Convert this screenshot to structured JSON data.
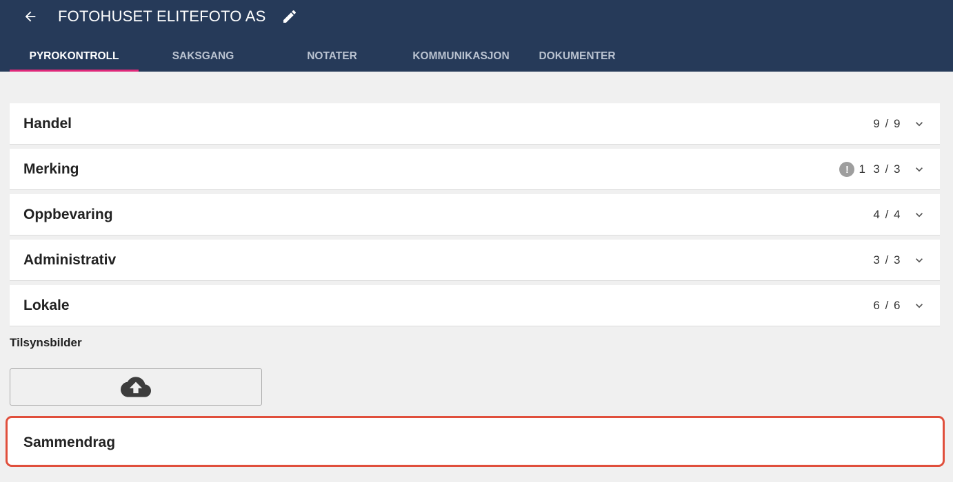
{
  "header": {
    "title": "FOTOHUSET ELITEFOTO AS",
    "back_icon": "arrow-left-icon",
    "edit_icon": "pencil-icon",
    "background": "#263a59"
  },
  "tabs": [
    {
      "label": "PYROKONTROLL",
      "active": true
    },
    {
      "label": "SAKSGANG",
      "active": false
    },
    {
      "label": "NOTATER",
      "active": false
    },
    {
      "label": "KOMMUNIKASJON",
      "active": false
    },
    {
      "label": "DOKUMENTER",
      "active": false
    }
  ],
  "accent_color": "#e0297a",
  "sections": [
    {
      "title": "Handel",
      "count": "9 / 9"
    },
    {
      "title": "Merking",
      "warning_count": "1",
      "count": "3 / 3"
    },
    {
      "title": "Oppbevaring",
      "count": "4 / 4"
    },
    {
      "title": "Administrativ",
      "count": "3 / 3"
    },
    {
      "title": "Lokale",
      "count": "6 / 6"
    }
  ],
  "images": {
    "label": "Tilsynsbilder",
    "upload_icon": "cloud-upload-icon"
  },
  "summary": {
    "label": "Sammendrag",
    "border_color": "#e04f3c"
  }
}
